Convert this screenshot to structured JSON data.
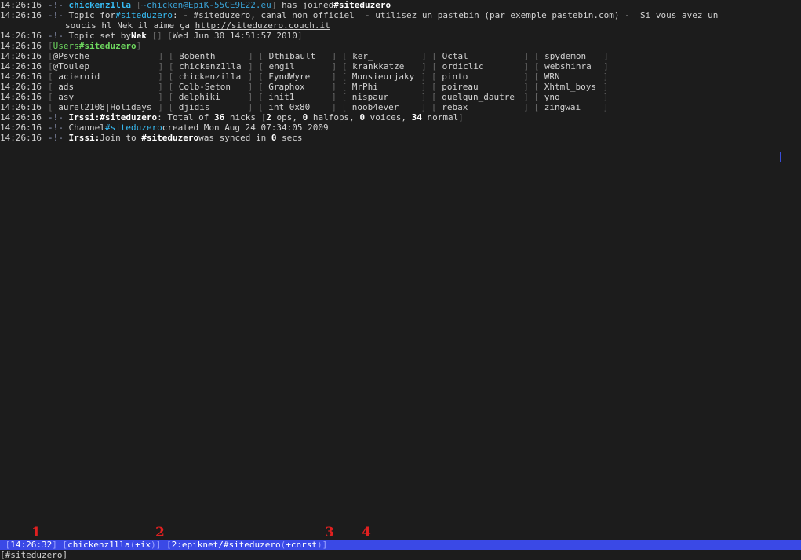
{
  "messages": {
    "join": {
      "time": "14:26:16",
      "nick": "chickenz1lla",
      "host": "~chicken@EpiK-55CE9E22.eu",
      "text": "has joined",
      "channel": "#siteduzero"
    },
    "topic": {
      "time": "14:26:16",
      "label": "Topic for",
      "channel": "#siteduzero",
      "line1": ": - #siteduzero, canal non officiel  - utilisez un pastebin (par exemple pastebin.com) -  Si vous avez un",
      "line2": "soucis hl Nek il aime ça ",
      "url": "http://siteduzero.couch.it"
    },
    "topic_set": {
      "time": "14:26:16",
      "label": "Topic set by",
      "nick": "Nek",
      "date": "Wed Jun 30 14:51:57 2010"
    },
    "users_header": {
      "time": "14:26:16",
      "label": "Users",
      "channel": "#siteduzero"
    },
    "total": {
      "time": "14:26:16",
      "prefix": "Irssi:",
      "channel": "#siteduzero",
      "t1": ": Total of ",
      "nicks": "36",
      "t2": " nicks ",
      "ops": "2",
      "t3": " ops, ",
      "halfops": "0",
      "t4": " halfops, ",
      "voices": "0",
      "t5": " voices, ",
      "normal": "34",
      "t6": " normal"
    },
    "created": {
      "time": "14:26:16",
      "label": "Channel",
      "channel": "#siteduzero",
      "text": "created Mon Aug 24 07:34:05 2009"
    },
    "synced": {
      "time": "14:26:16",
      "prefix": "Irssi:",
      "t1": "Join to ",
      "channel": "#siteduzero",
      "t2": "was synced in ",
      "secs": "0",
      "t3": " secs"
    }
  },
  "user_rows": [
    {
      "time": "14:26:16",
      "users": [
        "@Psyche",
        "Bobenth",
        "Dthibault",
        "ker_",
        "Octal",
        "spydemon"
      ]
    },
    {
      "time": "14:26:16",
      "users": [
        "@Toulep",
        "chickenz1lla",
        "engil",
        "krankkatze",
        "ordiclic",
        "webshinra"
      ]
    },
    {
      "time": "14:26:16",
      "users": [
        "acieroid",
        "chickenzilla",
        "FyndWyre",
        "Monsieurjaky",
        "pinto",
        "WRN"
      ]
    },
    {
      "time": "14:26:16",
      "users": [
        "ads",
        "Colb-Seton",
        "Graphox",
        "MrPhi",
        "poireau",
        "Xhtml_boys"
      ]
    },
    {
      "time": "14:26:16",
      "users": [
        "asy",
        "delphiki",
        "init1",
        "nispaur",
        "quelqun_dautre",
        "yno"
      ]
    },
    {
      "time": "14:26:16",
      "users": [
        "aurel2108|Holidays",
        "djidis",
        "int_0x80_",
        "noob4ever",
        "rebax",
        "zingwai"
      ]
    }
  ],
  "statusbar": {
    "clock": "14:26:32",
    "nick": "chickenz1lla",
    "umode": "+ix",
    "window": "2:epiknet/#siteduzero",
    "cmode": "+cnrst"
  },
  "prompt": "[#siteduzero]",
  "annotations": [
    "1",
    "2",
    "3",
    "4"
  ]
}
